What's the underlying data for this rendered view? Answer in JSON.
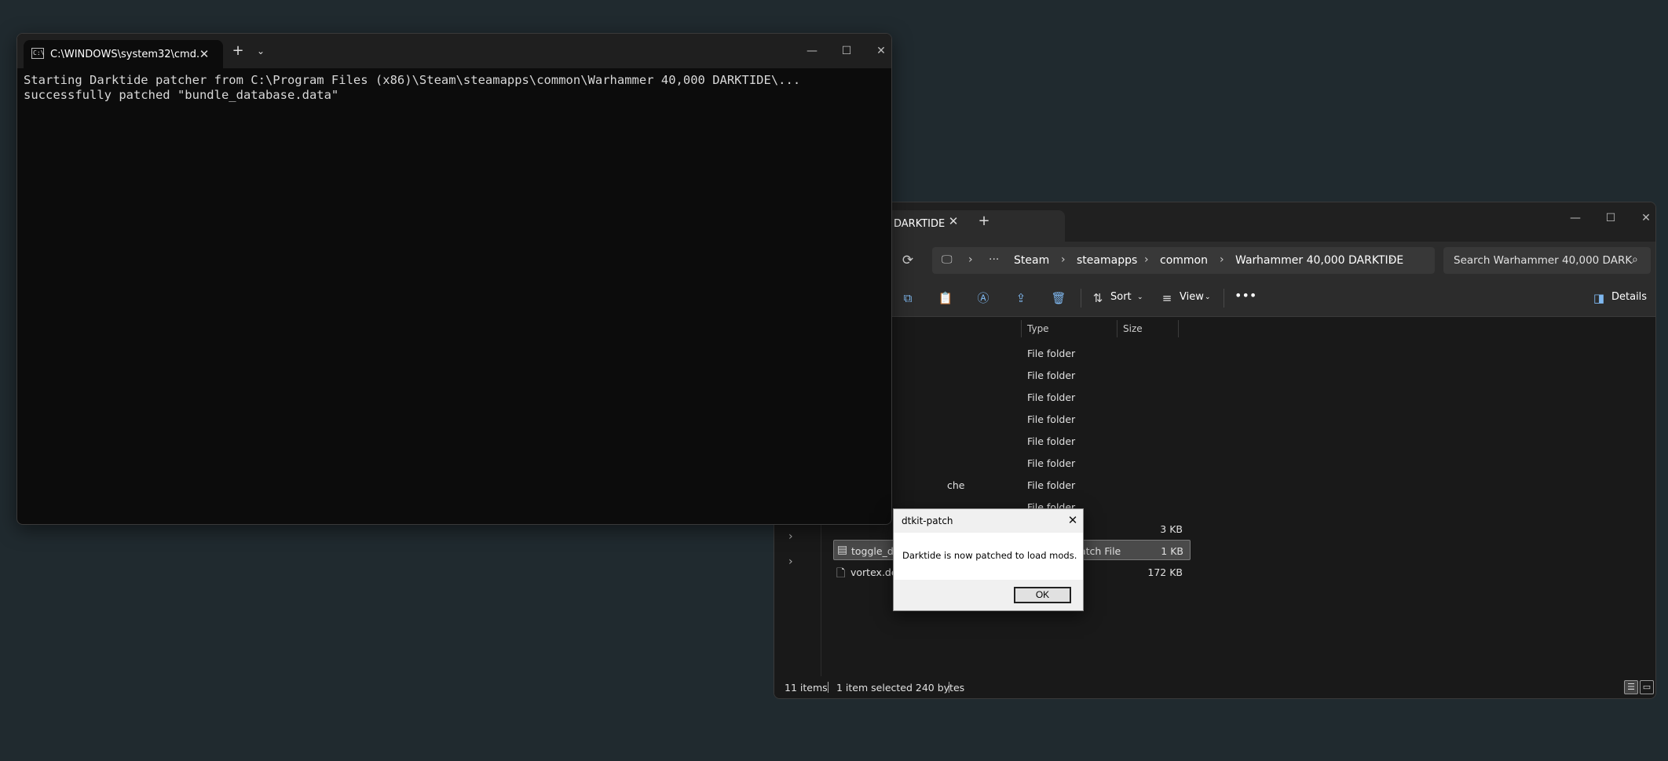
{
  "terminal": {
    "tab_title": "C:\\WINDOWS\\system32\\cmd.",
    "tab_icon_text": "C:\\",
    "lines": [
      "Starting Darktide patcher from C:\\Program Files (x86)\\Steam\\steamapps\\common\\Warhammer 40,000 DARKTIDE\\...",
      "successfully patched \"bundle_database.data\""
    ]
  },
  "explorer": {
    "tab_title": "DARKTIDE",
    "breadcrumbs": [
      "Steam",
      "steamapps",
      "common",
      "Warhammer 40,000 DARKTIDE"
    ],
    "search_placeholder": "Search Warhammer 40,000 DARK",
    "toolbar": {
      "sort_label": "Sort",
      "view_label": "View",
      "details_label": "Details"
    },
    "columns": {
      "type": "Type",
      "size": "Size"
    },
    "rows": [
      {
        "name": "",
        "type": "File folder",
        "size": ""
      },
      {
        "name": "",
        "type": "File folder",
        "size": ""
      },
      {
        "name": "",
        "type": "File folder",
        "size": ""
      },
      {
        "name": "",
        "type": "File folder",
        "size": ""
      },
      {
        "name": "",
        "type": "File folder",
        "size": ""
      },
      {
        "name": "",
        "type": "File folder",
        "size": ""
      },
      {
        "name": "che",
        "type": "File folder",
        "size": ""
      },
      {
        "name": "",
        "type": "File folder",
        "size": ""
      },
      {
        "name": "",
        "type": "",
        "size": "3 KB"
      },
      {
        "name": "toggle_da",
        "type": "atch File",
        "size": "1 KB"
      },
      {
        "name": "vortex.dep",
        "type": "",
        "size": "172 KB"
      }
    ],
    "status": {
      "items": "11 items",
      "selected": "1 item selected  240 bytes"
    }
  },
  "dialog": {
    "title": "dtkit-patch",
    "message": "Darktide is now patched to load mods.",
    "ok_label": "OK"
  }
}
